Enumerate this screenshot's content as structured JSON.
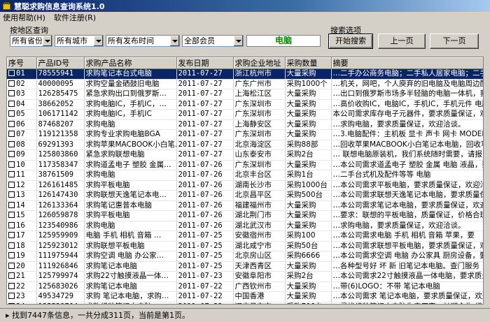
{
  "window": {
    "title": "慧聪求购信息查询系统1.0"
  },
  "menu": {
    "items": [
      "使用帮助(H)",
      "软件注册(R)"
    ]
  },
  "filters": {
    "group_label": "按地区查询",
    "province": "所有省份",
    "city": "所有城市",
    "time": "所有发布时间",
    "member": "全部会员",
    "keyword": "电脑"
  },
  "search": {
    "group_label": "搜索选项",
    "start_label": "开始搜索",
    "prev_label": "上一页",
    "next_label": "下一页"
  },
  "table": {
    "columns": [
      "序号",
      "产品ID号",
      "求购产品名称",
      "发布日期",
      "求购企业地址",
      "采购数量",
      "摘要"
    ],
    "rows": [
      [
        "01",
        "78555941",
        "求购笔记本台式电脑",
        "2011-07-27",
        "浙江杭州市",
        "大量采购",
        "…二手办公商务电脑；二手私人居家电脑；二手"
      ],
      [
        "02",
        "40000095",
        "求购空量金硒鼓旧电脑",
        "2011-07-27",
        "广东广州市",
        "采购1000个",
        "…机关，网吧，个人庾弃的旧电脑及电脑周边配"
      ],
      [
        "03",
        "126285475",
        "紧急求购出口到俄罗斯…",
        "2011-07-27",
        "上海松江区",
        "大量采购",
        "…出口到俄罗斯市场多半轻脑的电脑一体机，我"
      ],
      [
        "04",
        "38662052",
        "求购电脑IC，手机IC，…",
        "2011-07-27",
        "广东深圳市",
        "大量采购",
        "…高价收购IC，电脑IC，手机IC，手机元件 电脑元"
      ],
      [
        "05",
        "106171142",
        "求购电脑IC，手机IC",
        "2011-07-27",
        "广东深圳市",
        "大量采购",
        "本公司需求库存电子元器件，要求质量保证，欢迎"
      ],
      [
        "06",
        "87468207",
        "求购电脑",
        "2011-07-27",
        "上海静安区",
        "大量采购",
        "…求购电脑，要求质量保证，欢迎洽谈。"
      ],
      [
        "07",
        "119121358",
        "求购专业求购电脑BGA",
        "2011-07-27",
        "广东深圳市",
        "大量采购",
        "…3.电脑配件：主机板 显卡 声卡 网卡 MODEM"
      ],
      [
        "08",
        "69291393",
        "求购苹果MACBOOK小白笔…",
        "2011-07-27",
        "北京海淀区",
        "采购88部",
        "…回收苹果MACBOOK小白笔记本电脑，回收苹果"
      ],
      [
        "09",
        "125803860",
        "紧急求购联想电脑",
        "2011-07-27",
        "山东泰安市",
        "采购2台",
        "… 联想电脑原装机，我们系统随时需要，请报"
      ],
      [
        "10",
        "117358347",
        "求购道孟电子 塑胶 金属…",
        "2011-07-26",
        "广东深圳市",
        "大量采购",
        "…本公司需求道孟电子 塑胶 金属 电脑 液晶，要"
      ],
      [
        "11",
        "38761509",
        "求购电脑",
        "2011-07-26",
        "北京丰台区",
        "采购1台",
        "…二手台式机及配件等等 电脑"
      ],
      [
        "12",
        "126161485",
        "求购平板电脑",
        "2011-07-26",
        "湖南长沙市",
        "采购1000台",
        "…本公司需求平板电脑，要求质量保证，欢迎洽谈"
      ],
      [
        "13",
        "126147430",
        "求购联想天逸笔记本电…",
        "2011-07-26",
        "北京昌平区",
        "采购500台",
        "…本公司需求联想天逸笔记本电脑，要求质量保证"
      ],
      [
        "14",
        "126133364",
        "求购笔记惠普本电脑",
        "2011-07-26",
        "福建福州市",
        "大量采购",
        "…本公司需求笔记本电脑，要求质量保证，欢迎洽"
      ],
      [
        "15",
        "126059878",
        "求购平板电脑",
        "2011-07-26",
        "湖北荆门市",
        "大量采购",
        "…要求：联想的平板电脑，质量保证，价格合理，"
      ],
      [
        "16",
        "123540986",
        "求购电脑",
        "2011-07-26",
        "湖北武汉市",
        "大量采购",
        "…求购电脑，要求质量保证，欢迎洽谈。"
      ],
      [
        "17",
        "125959909",
        "电脑 手机 相机 音箱 …",
        "2011-07-25",
        "安徽宿州市",
        "采购100",
        "…本公司需求电脑 手机 相机 音箱 苹果，要"
      ],
      [
        "18",
        "125923012",
        "求购联想平板电脑",
        "2011-07-25",
        "湖北咸宁市",
        "采购50台",
        "…本公司需求联想平板电脑，要求质量保证，欢迎"
      ],
      [
        "19",
        "111975944",
        "求购空调 电脑 办公家…",
        "2011-07-25",
        "北京房山区",
        "采购6666",
        "…本公司需求空调 电脑 办公家具 厨房设备，要"
      ],
      [
        "20",
        "111926846",
        "求购笔记本电脑",
        "2011-07-25",
        "天津西青区",
        "大量采购",
        "…各种型号好 坏 新 旧笔记本电脑。查门服务"
      ],
      [
        "21",
        "125799974",
        "求购22寸触摸液晶一体…",
        "2011-07-23",
        "安徽阜阳市",
        "采购2台",
        "…本公司需求22寸触摸液晶一体电脑，要求质量保"
      ],
      [
        "22",
        "125683026",
        "求购笔记本电脑",
        "2011-07-22",
        "广西钦州市",
        "大量采购",
        "…带(6)LOGO：不带 笔记本电脑"
      ],
      [
        "23",
        "49534729",
        "求购 笔记本电脑，求购…",
        "2011-07-22",
        "中国香港",
        "大量采购",
        "…本公司需求 笔记本电脑，要求质量保证，欢迎"
      ],
      [
        "24",
        "125539704",
        "求购组装笔记本电脑",
        "2011-07-22",
        "辽宁丹东市",
        "采购700台",
        "…寻找组装笔记本电脑生产厂家，长期合作 组"
      ]
    ]
  },
  "status": {
    "text": "找到7447条信息，一共分成311页，当前是第1页。"
  }
}
